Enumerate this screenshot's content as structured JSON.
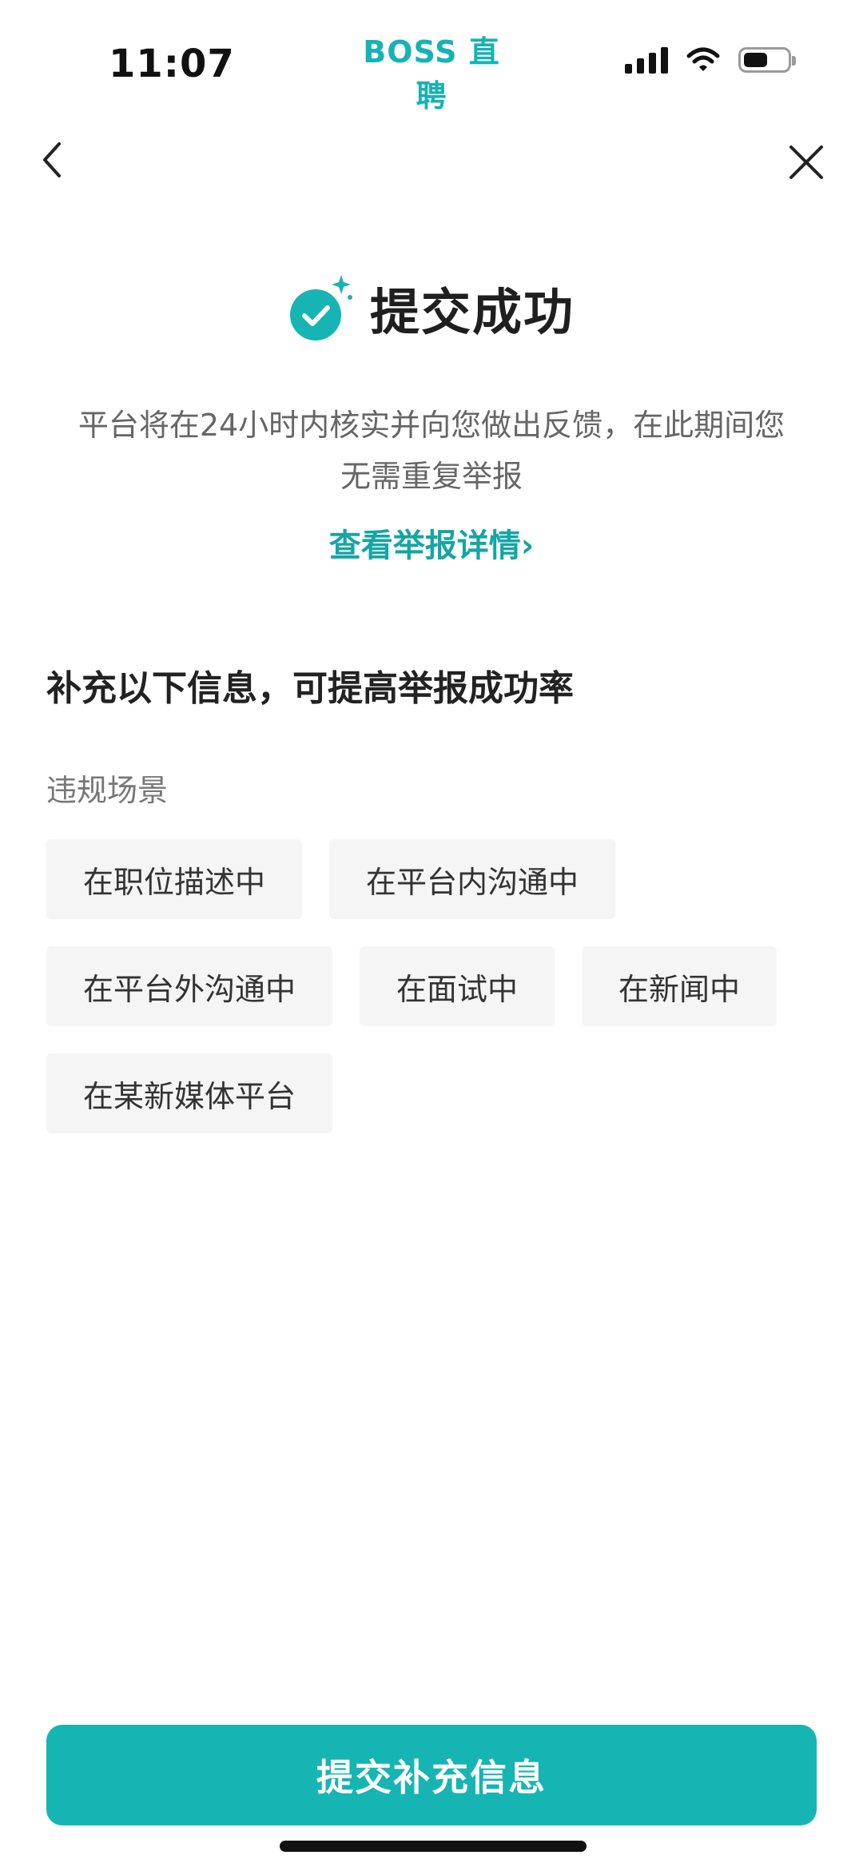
{
  "status_bar": {
    "time": "11:07",
    "brand": "BOSS 直聘",
    "battery_level": 0.55,
    "icons": [
      "signal-icon",
      "wifi-icon",
      "battery-icon"
    ]
  },
  "nav": {
    "back_icon": "chevron-left-icon",
    "close_icon": "close-icon"
  },
  "success": {
    "icon": "check-circle-icon",
    "title": "提交成功",
    "description_line1": "平台将在24小时内核实并向您做出反馈，在此期间您",
    "description_line2": "无需重复举报",
    "detail_link": "查看举报详情",
    "detail_chevron": "›"
  },
  "supplement": {
    "title": "补充以下信息，可提高举报成功率",
    "scene_label": "违规场景",
    "tags": [
      "在职位描述中",
      "在平台内沟通中",
      "在平台外沟通中",
      "在面试中",
      "在新闻中",
      "在某新媒体平台"
    ]
  },
  "submit_label": "提交补充信息",
  "colors": {
    "accent": "#16b5b3",
    "link": "#15a5a5",
    "tag_bg": "#f5f5f5",
    "text_muted": "#666666"
  }
}
